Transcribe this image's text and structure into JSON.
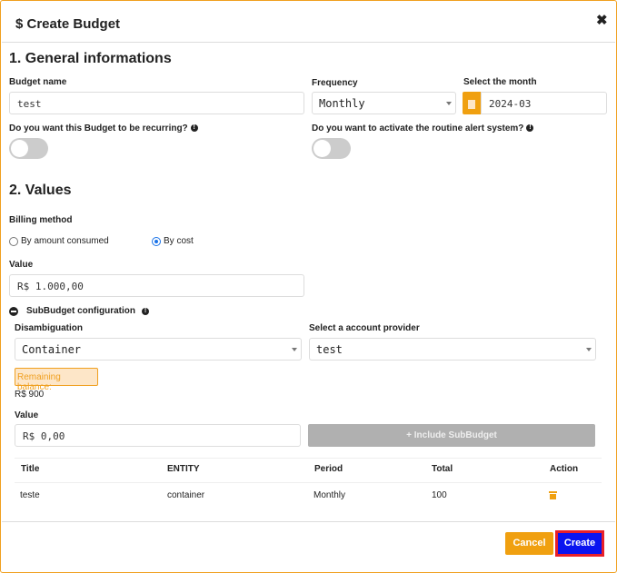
{
  "header": {
    "title": "$ Create Budget",
    "close_icon": "close-icon"
  },
  "general": {
    "heading": "1. General informations",
    "budget_name_label": "Budget name",
    "budget_name_value": "test",
    "frequency_label": "Frequency",
    "frequency_value": "Monthly",
    "month_label": "Select the month",
    "month_value": "2024-03",
    "recurring_label": "Do you want this Budget to be recurring?",
    "recurring_on": false,
    "alert_label": "Do you want to activate the routine alert system?",
    "alert_on": false
  },
  "values": {
    "heading": "2. Values",
    "billing_label": "Billing method",
    "billing_options": [
      "By amount consumed",
      "By cost"
    ],
    "billing_selected": "By cost",
    "value_label": "Value",
    "value": "R$ 1.000,00",
    "subbudget_label": "SubBudget configuration",
    "disambiguation_label": "Disambiguation",
    "disambiguation_value": "Container",
    "provider_label": "Select a account provider",
    "provider_value": "test",
    "remaining_label": "Remaining balance:",
    "remaining_value": "R$ 900",
    "sub_value_label": "Value",
    "sub_value": "R$ 0,00",
    "include_button": "+ Include SubBudget"
  },
  "table": {
    "columns": [
      "Title",
      "ENTITY",
      "Period",
      "Total",
      "Action"
    ],
    "rows": [
      {
        "title": "teste",
        "entity": "container",
        "period": "Monthly",
        "total": "100",
        "action_icon": "trash-icon"
      }
    ]
  },
  "footer": {
    "cancel": "Cancel",
    "create": "Create"
  },
  "colors": {
    "accent": "#f0a010",
    "create": "#0a14f0",
    "highlight": "#e8202a"
  }
}
